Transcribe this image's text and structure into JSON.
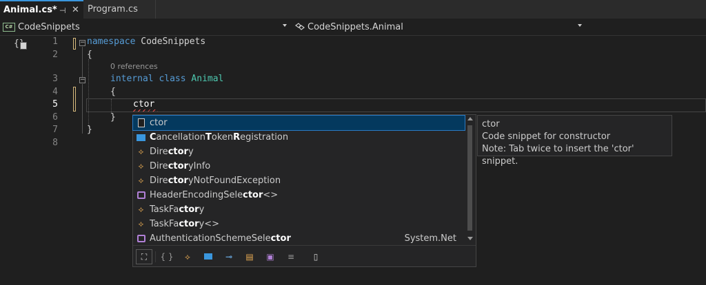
{
  "tabs": [
    {
      "label": "Animal.cs*",
      "active": true
    },
    {
      "label": "Program.cs",
      "active": false
    }
  ],
  "icons": {
    "pin": "pin-icon",
    "close": "close-icon"
  },
  "navbar": {
    "project": {
      "badge": "C#",
      "label": "CodeSnippets"
    },
    "class_selector": {
      "label": "CodeSnippets.Animal"
    }
  },
  "editor": {
    "line_numbers": [
      "1",
      "2",
      "3",
      "4",
      "5",
      "6",
      "7",
      "8"
    ],
    "current_line": "5",
    "codelens": "0 references",
    "code": {
      "line1_keyword": "namespace",
      "line1_name": " CodeSnippets",
      "line2": "{",
      "line3_kw1": "internal",
      "line3_kw2": " class",
      "line3_type": " Animal",
      "line4": "{",
      "line5": "ctor",
      "line6": "}",
      "line7": "}"
    }
  },
  "completion": {
    "items": [
      {
        "icon": "snippet-icon",
        "parts": [
          [
            "",
            "ctor"
          ]
        ],
        "selected": true
      },
      {
        "icon": "struct-icon",
        "parts": [
          [
            "C",
            "ancellation"
          ],
          [
            "T",
            "o"
          ],
          [
            "",
            "ken"
          ],
          [
            "R",
            "egistration"
          ]
        ]
      },
      {
        "icon": "class-icon",
        "parts": [
          [
            "Dire",
            ""
          ],
          [
            "ctor",
            "y"
          ]
        ]
      },
      {
        "icon": "class-icon",
        "parts": [
          [
            "Dire",
            ""
          ],
          [
            "ctor",
            "yInfo"
          ]
        ]
      },
      {
        "icon": "class-icon",
        "parts": [
          [
            "Dire",
            ""
          ],
          [
            "ctor",
            "yNotFoundException"
          ]
        ]
      },
      {
        "icon": "delegate-icon",
        "parts": [
          [
            "HeaderEncodingSele",
            ""
          ],
          [
            "ctor",
            "<>"
          ]
        ]
      },
      {
        "icon": "class-icon",
        "parts": [
          [
            "TaskFa",
            ""
          ],
          [
            "ctor",
            "y"
          ]
        ]
      },
      {
        "icon": "class-icon",
        "parts": [
          [
            "TaskFa",
            ""
          ],
          [
            "ctor",
            "y<>"
          ]
        ]
      },
      {
        "icon": "delegate-icon",
        "parts": [
          [
            "AuthenticationSchemeSele",
            ""
          ],
          [
            "ctor",
            ""
          ]
        ],
        "namespace": "System.Net"
      }
    ],
    "filters": [
      "expand-filter-icon",
      "namespace-filter-icon",
      "class-filter-icon",
      "struct-filter-icon",
      "interface-filter-icon",
      "enum-filter-icon",
      "delegate-filter-icon",
      "module-filter-icon",
      "snippet-filter-icon"
    ]
  },
  "tooltip": {
    "title": "ctor",
    "description": "Code snippet for constructor",
    "note": "Note: Tab twice to insert the 'ctor' snippet."
  },
  "colors": {
    "accent": "#3a96dd",
    "selection": "#04395e",
    "keyword": "#569cd6",
    "type": "#4ec9b0"
  }
}
